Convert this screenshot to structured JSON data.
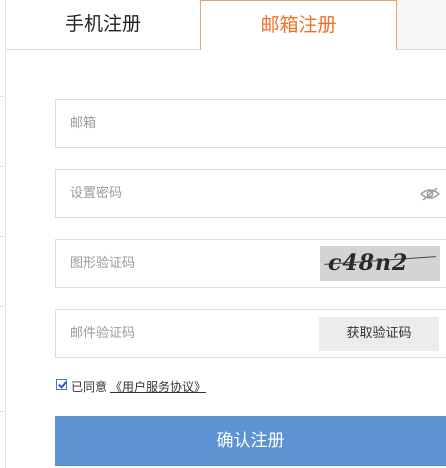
{
  "tabs": {
    "phone_label": "手机注册",
    "email_label": "邮箱注册",
    "active": "email"
  },
  "form": {
    "email": {
      "placeholder": "邮箱",
      "value": ""
    },
    "password": {
      "placeholder": "设置密码",
      "value": "",
      "toggle_icon": "eye-hidden-icon"
    },
    "captcha": {
      "placeholder": "图形验证码",
      "value": "",
      "image_text": "c48n2"
    },
    "email_code": {
      "placeholder": "邮件验证码",
      "value": "",
      "button_label": "获取验证码"
    }
  },
  "agreement": {
    "checked": true,
    "label": "已同意",
    "link_text": "《用户服务协议》"
  },
  "submit_label": "确认注册",
  "colors": {
    "accent_orange": "#f0702a",
    "submit_blue": "#5b93d3",
    "field_border": "#dedede"
  }
}
